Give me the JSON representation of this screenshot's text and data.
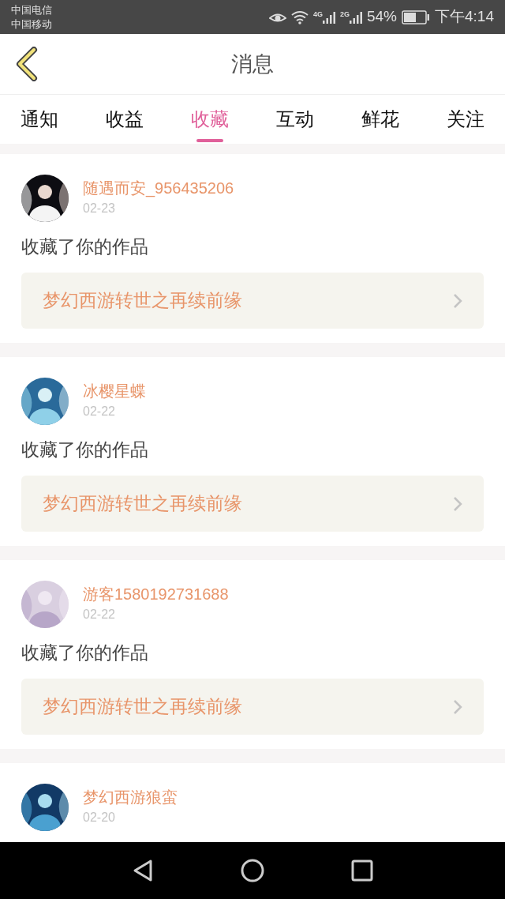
{
  "status_bar": {
    "carriers": [
      "中国电信",
      "中国移动"
    ],
    "network_1": "4G",
    "network_2": "2G",
    "battery": "54%",
    "time": "下午4:14"
  },
  "header": {
    "title": "消息"
  },
  "tabs": [
    {
      "label": "通知",
      "selected": false
    },
    {
      "label": "收益",
      "selected": false
    },
    {
      "label": "收藏",
      "selected": true
    },
    {
      "label": "互动",
      "selected": false
    },
    {
      "label": "鲜花",
      "selected": false
    },
    {
      "label": "关注",
      "selected": false
    }
  ],
  "messages": [
    {
      "name": "随遇而安_956435206",
      "date": "02-23",
      "action": "收藏了你的作品",
      "work": "梦幻西游转世之再续前缘"
    },
    {
      "name": "冰樱星蝶",
      "date": "02-22",
      "action": "收藏了你的作品",
      "work": "梦幻西游转世之再续前缘"
    },
    {
      "name": "游客1580192731688",
      "date": "02-22",
      "action": "收藏了你的作品",
      "work": "梦幻西游转世之再续前缘"
    },
    {
      "name": "梦幻西游狼蛮",
      "date": "02-20"
    }
  ]
}
